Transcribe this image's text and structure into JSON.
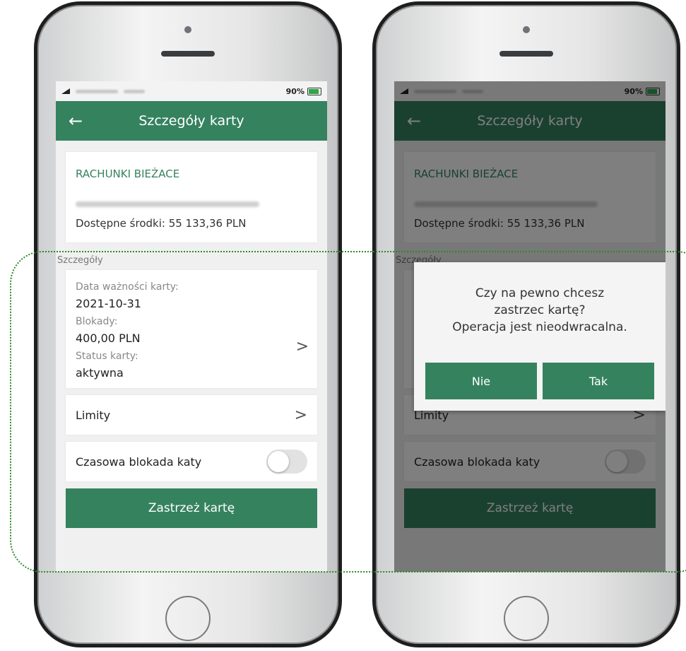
{
  "status_bar": {
    "battery": "90%"
  },
  "app_bar": {
    "back_icon": "arrow-left-icon",
    "title": "Szczegóły karty"
  },
  "account": {
    "name": "RACHUNKI BIEŻACE",
    "available": "Dostępne środki: 55 133,36 PLN"
  },
  "details": {
    "section_label": "Szczegóły",
    "expiry_label": "Data ważności karty:",
    "expiry_value": "2021-10-31",
    "blocks_label": "Blokady:",
    "blocks_value": "400,00 PLN",
    "status_label": "Status karty:",
    "status_value": "aktywna"
  },
  "limits": {
    "label": "Limity"
  },
  "temp_block": {
    "label": "Czasowa blokada katy",
    "enabled": false
  },
  "block_card": {
    "label": "Zastrzeż kartę"
  },
  "dialog": {
    "line1": "Czy na pewno chcesz",
    "line2": "zastrzec kartę?",
    "line3": "Operacja jest nieodwracalna.",
    "no_label": "Nie",
    "yes_label": "Tak"
  },
  "colors": {
    "brand_green": "#35825f",
    "highlight": "#2b8a2b"
  }
}
